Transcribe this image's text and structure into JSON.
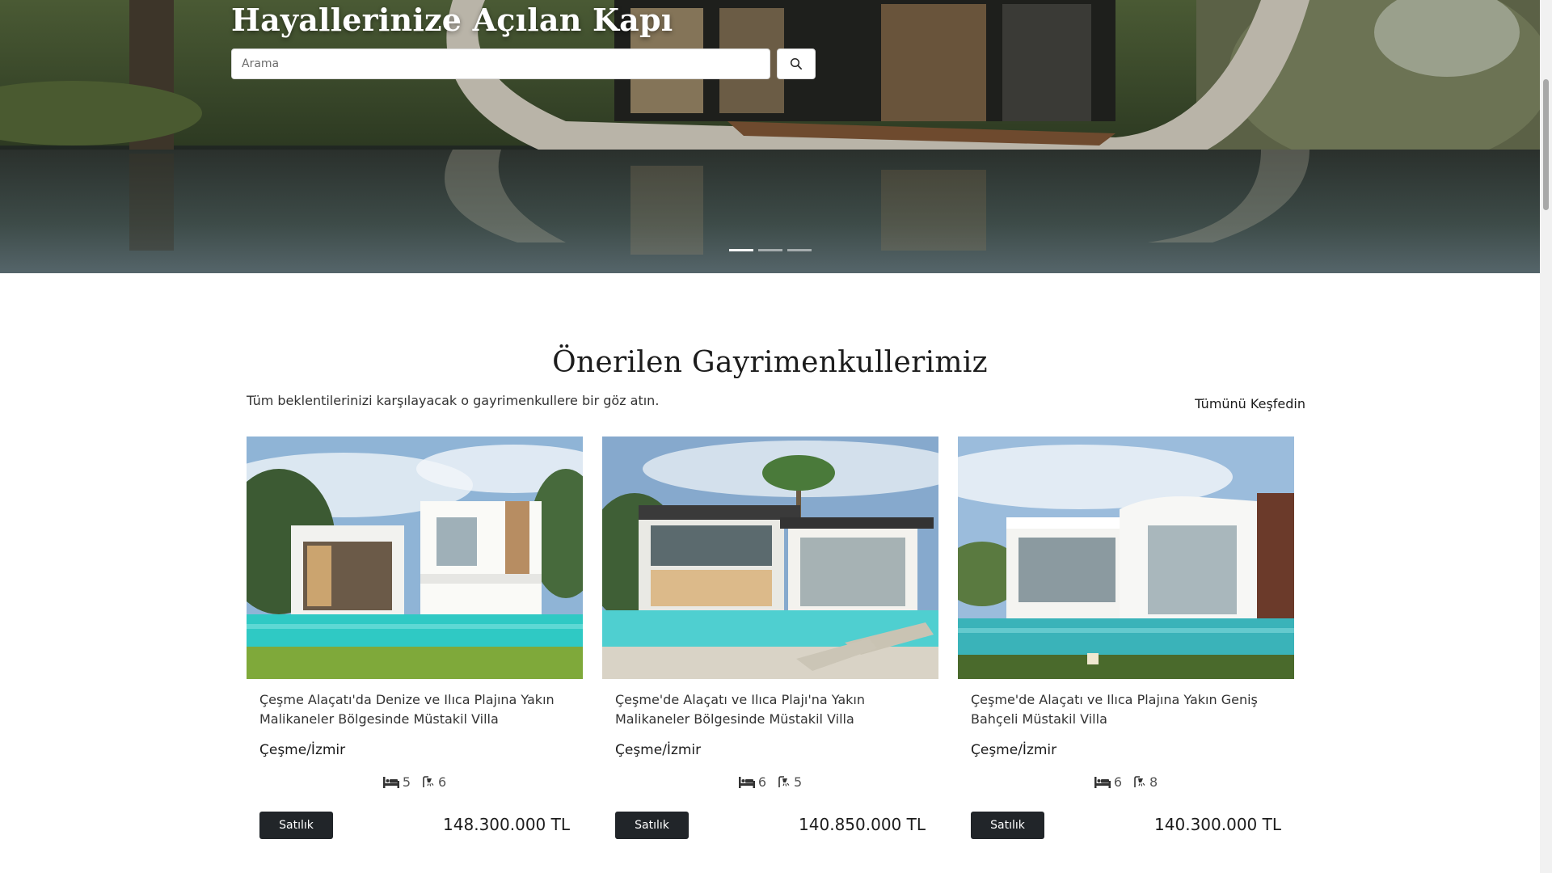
{
  "hero": {
    "title": "Hayallerinize Açılan Kapı",
    "search_placeholder": "Arama",
    "search_value": "",
    "slides": [
      true,
      false,
      false
    ]
  },
  "section": {
    "title": "Önerilen Gayrimenkullerimiz",
    "subtitle": "Tüm beklentilerinizi karşılayacak o gayrimenkullere bir göz atın.",
    "explore_label": "Tümünü Keşfedin"
  },
  "listings": [
    {
      "title": "Çeşme Alaçatı'da Denize ve Ilıca Plajına Yakın Malikaneler Bölgesinde Müstakil Villa",
      "location": "Çeşme/İzmir",
      "bedrooms": "5",
      "bathrooms": "6",
      "status": "Satılık",
      "price": "148.300.000 TL"
    },
    {
      "title": "Çeşme'de Alaçatı ve Ilıca Plajı'na Yakın Malikaneler Bölgesinde Müstakil Villa",
      "location": "Çeşme/İzmir",
      "bedrooms": "6",
      "bathrooms": "5",
      "status": "Satılık",
      "price": "140.850.000 TL"
    },
    {
      "title": "Çeşme'de Alaçatı ve Ilıca Plajına Yakın Geniş Bahçeli Müstakil Villa",
      "location": "Çeşme/İzmir",
      "bedrooms": "6",
      "bathrooms": "8",
      "status": "Satılık",
      "price": "140.300.000 TL"
    }
  ],
  "icons": {
    "search": "search-icon",
    "bed": "bed-icon",
    "bath": "shower-icon"
  },
  "colors": {
    "button_dark": "#212529",
    "pool_turquoise": "#2fc9c4"
  }
}
